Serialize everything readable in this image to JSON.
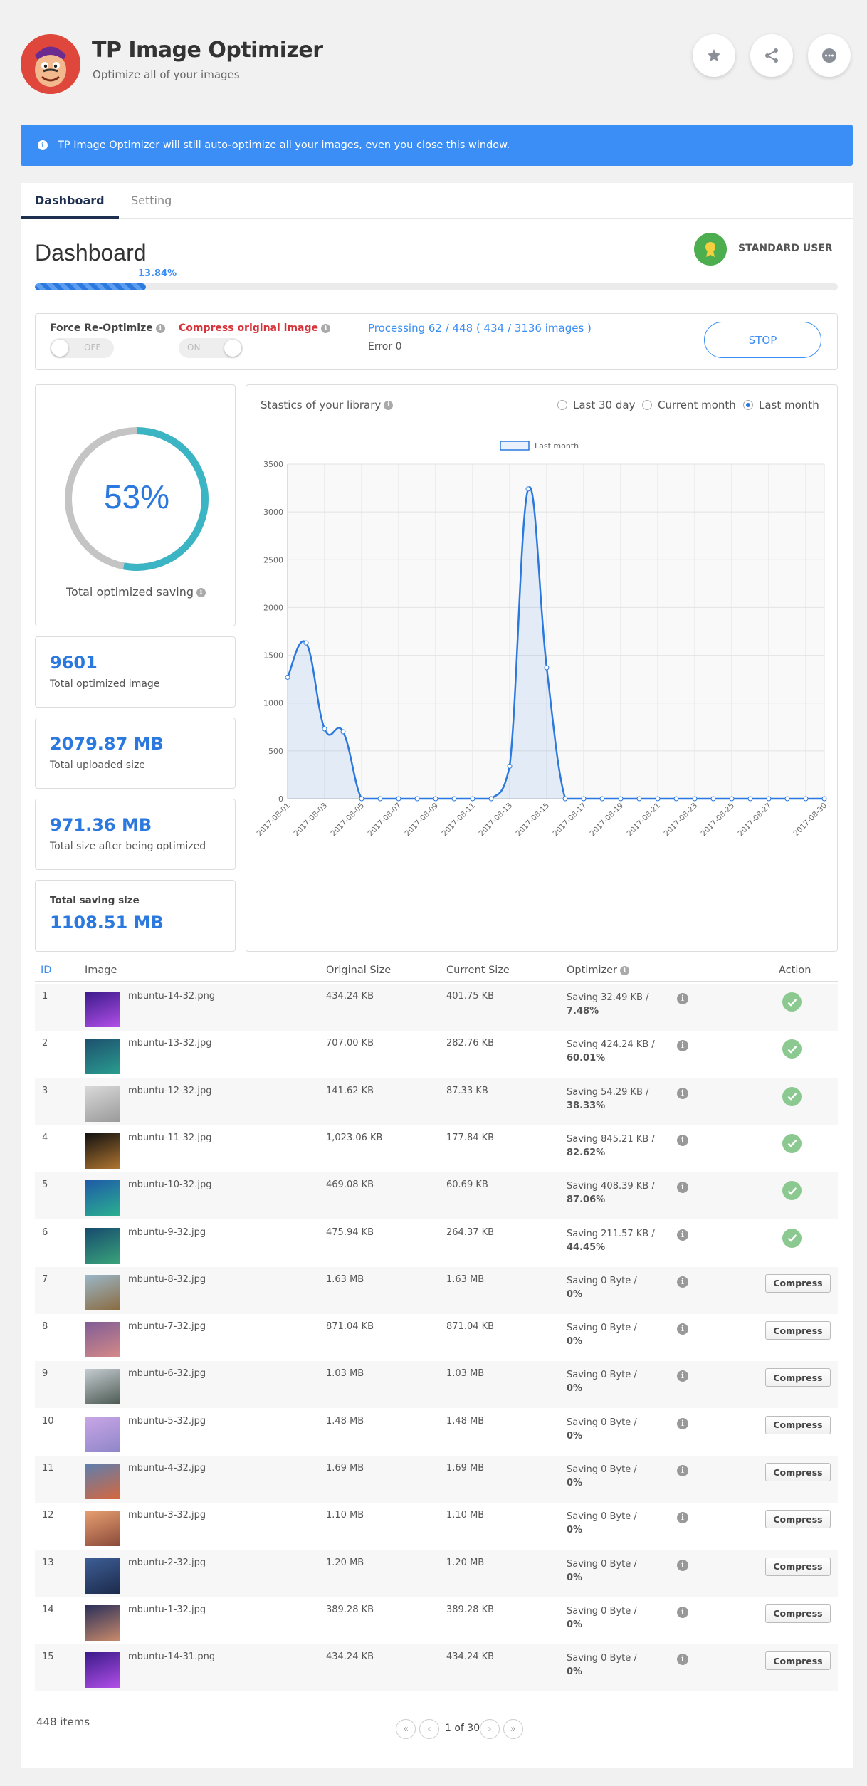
{
  "header": {
    "title": "TP Image Optimizer",
    "subtitle": "Optimize all of your images",
    "buttons": [
      "star-icon",
      "share-icon",
      "chat-icon"
    ]
  },
  "notice": {
    "text": "TP Image Optimizer will still auto-optimize all your images, even you close this window."
  },
  "tabs": [
    {
      "label": "Dashboard",
      "active": true
    },
    {
      "label": "Setting",
      "active": false
    }
  ],
  "dashboard": {
    "title": "Dashboard",
    "user_badge": "STANDARD USER",
    "progress_label": "13.84%",
    "progress_value": 0.1384
  },
  "controls": {
    "force_label": "Force Re-Optimize",
    "force_state": "OFF",
    "compress_label": "Compress original image",
    "compress_state": "ON",
    "processing": "Processing 62 / 448 ( 434 / 3136 images )",
    "error": "Error 0",
    "stop_label": "STOP"
  },
  "saving": {
    "percent_label": "53%",
    "percent": 53,
    "label": "Total optimized saving"
  },
  "stats": {
    "optimized_count": "9601",
    "optimized_label": "Total optimized image",
    "uploaded": "2079.87 MB",
    "uploaded_label": "Total uploaded size",
    "after": "971.36 MB",
    "after_label": "Total size after being optimized",
    "saving_label": "Total saving size",
    "saving": "1108.51 MB"
  },
  "chart_panel": {
    "title": "Stastics of your library",
    "options": [
      "Last 30 day",
      "Current month",
      "Last month"
    ],
    "selected": "Last month"
  },
  "chart_data": {
    "type": "line",
    "legend": "Last month",
    "x": [
      "2017-08-01",
      "2017-08-02",
      "2017-08-03",
      "2017-08-04",
      "2017-08-05",
      "2017-08-06",
      "2017-08-07",
      "2017-08-08",
      "2017-08-09",
      "2017-08-10",
      "2017-08-11",
      "2017-08-12",
      "2017-08-13",
      "2017-08-14",
      "2017-08-15",
      "2017-08-16",
      "2017-08-17",
      "2017-08-18",
      "2017-08-19",
      "2017-08-20",
      "2017-08-21",
      "2017-08-22",
      "2017-08-23",
      "2017-08-24",
      "2017-08-25",
      "2017-08-26",
      "2017-08-27",
      "2017-08-28",
      "2017-08-29",
      "2017-08-30"
    ],
    "x_ticks": [
      "2017-08-01",
      "2017-08-03",
      "2017-08-05",
      "2017-08-07",
      "2017-08-09",
      "2017-08-11",
      "2017-08-13",
      "2017-08-15",
      "2017-08-17",
      "2017-08-19",
      "2017-08-21",
      "2017-08-23",
      "2017-08-25",
      "2017-08-27",
      "2017-08-30"
    ],
    "values": [
      1270,
      1630,
      730,
      700,
      0,
      0,
      0,
      0,
      0,
      0,
      0,
      0,
      340,
      3240,
      1370,
      0,
      0,
      0,
      0,
      0,
      0,
      0,
      0,
      0,
      0,
      0,
      0,
      0,
      0,
      0
    ],
    "y_ticks": [
      0,
      500,
      1000,
      1500,
      2000,
      2500,
      3000,
      3500
    ],
    "ylim": [
      0,
      3500
    ],
    "grid": true,
    "legend_position": "top-center"
  },
  "table": {
    "headers": {
      "id": "ID",
      "image": "Image",
      "original": "Original Size",
      "current": "Current Size",
      "optimizer": "Optimizer",
      "action": "Action"
    },
    "compress_label": "Compress",
    "rows": [
      {
        "id": "1",
        "name": "mbuntu-14-32.png",
        "original": "434.24 KB",
        "current": "401.75 KB",
        "saving": "Saving 32.49 KB /",
        "pct": "7.48%",
        "done": true,
        "thumb": [
          "#3a1a8a",
          "#b24fe8"
        ]
      },
      {
        "id": "2",
        "name": "mbuntu-13-32.jpg",
        "original": "707.00 KB",
        "current": "282.76 KB",
        "saving": "Saving 424.24 KB /",
        "pct": "60.01%",
        "done": true,
        "thumb": [
          "#1d4f6e",
          "#2a9d8f"
        ]
      },
      {
        "id": "3",
        "name": "mbuntu-12-32.jpg",
        "original": "141.62 KB",
        "current": "87.33 KB",
        "saving": "Saving 54.29 KB /",
        "pct": "38.33%",
        "done": true,
        "thumb": [
          "#d9d9d9",
          "#9a9a9a"
        ]
      },
      {
        "id": "4",
        "name": "mbuntu-11-32.jpg",
        "original": "1,023.06 KB",
        "current": "177.84 KB",
        "saving": "Saving 845.21 KB /",
        "pct": "82.62%",
        "done": true,
        "thumb": [
          "#111111",
          "#b07530"
        ]
      },
      {
        "id": "5",
        "name": "mbuntu-10-32.jpg",
        "original": "469.08 KB",
        "current": "60.69 KB",
        "saving": "Saving 408.39 KB /",
        "pct": "87.06%",
        "done": true,
        "thumb": [
          "#1e5aa8",
          "#2bb08f"
        ]
      },
      {
        "id": "6",
        "name": "mbuntu-9-32.jpg",
        "original": "475.94 KB",
        "current": "264.37 KB",
        "saving": "Saving 211.57 KB /",
        "pct": "44.45%",
        "done": true,
        "thumb": [
          "#164a6e",
          "#39a37a"
        ]
      },
      {
        "id": "7",
        "name": "mbuntu-8-32.jpg",
        "original": "1.63 MB",
        "current": "1.63 MB",
        "saving": "Saving 0 Byte /",
        "pct": "0%",
        "done": false,
        "thumb": [
          "#9bb7c9",
          "#8a6a3e"
        ]
      },
      {
        "id": "8",
        "name": "mbuntu-7-32.jpg",
        "original": "871.04 KB",
        "current": "871.04 KB",
        "saving": "Saving 0 Byte /",
        "pct": "0%",
        "done": false,
        "thumb": [
          "#7f5c96",
          "#d68a87"
        ]
      },
      {
        "id": "9",
        "name": "mbuntu-6-32.jpg",
        "original": "1.03 MB",
        "current": "1.03 MB",
        "saving": "Saving 0 Byte /",
        "pct": "0%",
        "done": false,
        "thumb": [
          "#c5ccd2",
          "#4d5a52"
        ]
      },
      {
        "id": "10",
        "name": "mbuntu-5-32.jpg",
        "original": "1.48 MB",
        "current": "1.48 MB",
        "saving": "Saving 0 Byte /",
        "pct": "0%",
        "done": false,
        "thumb": [
          "#c9a6e6",
          "#8f86c9"
        ]
      },
      {
        "id": "11",
        "name": "mbuntu-4-32.jpg",
        "original": "1.69 MB",
        "current": "1.69 MB",
        "saving": "Saving 0 Byte /",
        "pct": "0%",
        "done": false,
        "thumb": [
          "#5c7fb0",
          "#d6673c"
        ]
      },
      {
        "id": "12",
        "name": "mbuntu-3-32.jpg",
        "original": "1.10 MB",
        "current": "1.10 MB",
        "saving": "Saving 0 Byte /",
        "pct": "0%",
        "done": false,
        "thumb": [
          "#e8a071",
          "#8a4a3a"
        ]
      },
      {
        "id": "13",
        "name": "mbuntu-2-32.jpg",
        "original": "1.20 MB",
        "current": "1.20 MB",
        "saving": "Saving 0 Byte /",
        "pct": "0%",
        "done": false,
        "thumb": [
          "#3d5e96",
          "#1c2a4a"
        ]
      },
      {
        "id": "14",
        "name": "mbuntu-1-32.jpg",
        "original": "389.28 KB",
        "current": "389.28 KB",
        "saving": "Saving 0 Byte /",
        "pct": "0%",
        "done": false,
        "thumb": [
          "#2a2f5a",
          "#c98a6a"
        ]
      },
      {
        "id": "15",
        "name": "mbuntu-14-31.png",
        "original": "434.24 KB",
        "current": "434.24 KB",
        "saving": "Saving 0 Byte /",
        "pct": "0%",
        "done": false,
        "thumb": [
          "#3a1a8a",
          "#b24fe8"
        ]
      }
    ]
  },
  "footer": {
    "items": "448 items",
    "page_label": "1 of 30",
    "first": "«",
    "prev": "‹",
    "next": "›",
    "last": "»"
  },
  "colors": {
    "accent": "#3a8ef5",
    "donut": "#3bb4c4",
    "donut_track": "#c4c4c4",
    "line": "#2b79de"
  }
}
